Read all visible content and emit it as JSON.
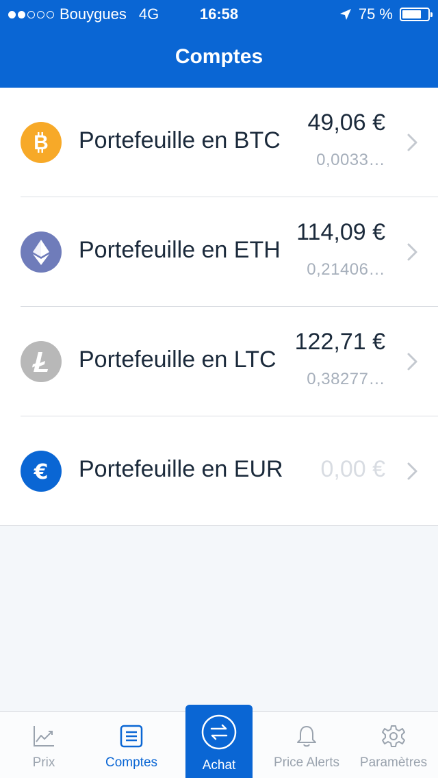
{
  "status_bar": {
    "carrier": "Bouygues",
    "network": "4G",
    "time": "16:58",
    "battery": "75 %",
    "battery_level": 0.75
  },
  "nav": {
    "title": "Comptes"
  },
  "colors": {
    "brand": "#0a66d4",
    "btc": "#f7a928",
    "eth": "#6f7cba",
    "ltc": "#b8b8b8",
    "eur": "#0a66d4"
  },
  "accounts": [
    {
      "name": "Portefeuille en BTC",
      "amount": "49,06 €",
      "sub": "0,0033…",
      "icon": "bitcoin-icon"
    },
    {
      "name": "Portefeuille en ETH",
      "amount": "114,09 €",
      "sub": "0,21406…",
      "icon": "ethereum-icon"
    },
    {
      "name": "Portefeuille en LTC",
      "amount": "122,71 €",
      "sub": "0,38277…",
      "icon": "litecoin-icon"
    },
    {
      "name": "Portefeuille en EUR",
      "amount": "0,00 €",
      "icon": "euro-icon"
    }
  ],
  "tabs": [
    {
      "label": "Prix",
      "icon": "chart-icon"
    },
    {
      "label": "Comptes",
      "icon": "list-icon"
    },
    {
      "label": "Achat",
      "icon": "exchange-icon"
    },
    {
      "label": "Price Alerts",
      "icon": "bell-icon"
    },
    {
      "label": "Paramètres",
      "icon": "gear-icon"
    }
  ]
}
